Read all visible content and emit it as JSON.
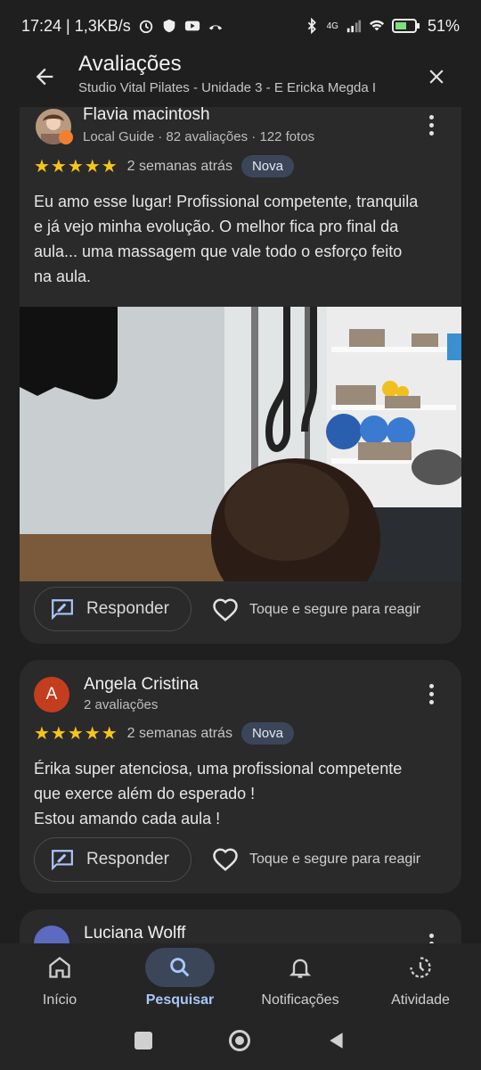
{
  "status_bar": {
    "time_net": "17:24 | 1,3KB/s",
    "network": "4G",
    "battery": "51%"
  },
  "header": {
    "title": "Avaliações",
    "subtitle": "Studio Vital Pilates - Unidade 3 - E Ericka Megda I"
  },
  "reviews": [
    {
      "author": "Flavia macintosh",
      "meta": "Local Guide · 82 avaliações · 122 fotos",
      "stars": "★★★★★",
      "date": "2 semanas atrás",
      "badge": "Nova",
      "text": "Eu amo esse lugar! Profissional competente, tranquila\ne já vejo minha evolução. O melhor fica pro final da\naula... uma massagem que vale todo o esforço feito\nna aula.",
      "reply": "Responder",
      "react": "Toque e segure para reagir"
    },
    {
      "author": "Angela Cristina",
      "initial": "A",
      "meta": "2 avaliações",
      "stars": "★★★★★",
      "date": "2 semanas atrás",
      "badge": "Nova",
      "text": "Érika super atenciosa, uma profissional competente\nque exerce além do esperado !\nEstou amando cada aula !",
      "reply": "Responder",
      "react": "Toque e segure para reagir"
    },
    {
      "author": "Luciana Wolff"
    }
  ],
  "bottom_nav": [
    {
      "label": "Início",
      "icon": "home-icon"
    },
    {
      "label": "Pesquisar",
      "icon": "search-icon",
      "active": true
    },
    {
      "label": "Notificações",
      "icon": "bell-icon"
    },
    {
      "label": "Atividade",
      "icon": "activity-icon"
    }
  ],
  "colors": {
    "background": "#1f1f1f",
    "card": "#2a2a2a",
    "accent": "#a8c7fa",
    "star": "#f5c518",
    "badge": "#3b4658"
  }
}
